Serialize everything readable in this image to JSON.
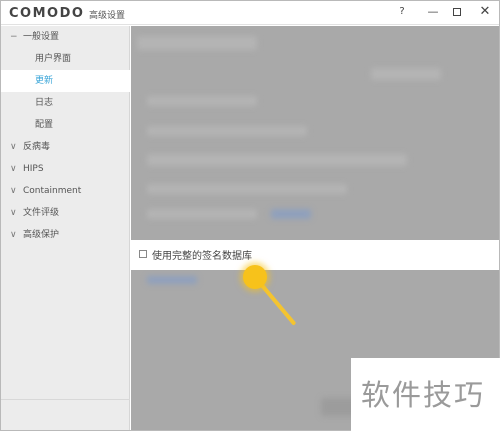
{
  "window": {
    "logo": "COMODO",
    "title": "高级设置",
    "help": "?",
    "minimize": "—",
    "close": "✕"
  },
  "sidebar": {
    "items": [
      {
        "label": "一般设置",
        "chevron": "−"
      },
      {
        "label": "用户界面"
      },
      {
        "label": "更新"
      },
      {
        "label": "日志"
      },
      {
        "label": "配置"
      },
      {
        "label": "反病毒",
        "chevron": "∨"
      },
      {
        "label": "HIPS",
        "chevron": "∨"
      },
      {
        "label": "Containment",
        "chevron": "∨"
      },
      {
        "label": "文件评级",
        "chevron": "∨"
      },
      {
        "label": "高级保护",
        "chevron": "∨"
      }
    ],
    "selected": "更新"
  },
  "content": {
    "option_label": "使用完整的签名数据库",
    "option_checked": false
  },
  "watermark": {
    "text": "软件技巧"
  },
  "colors": {
    "accent": "#3aa5d8",
    "cursor": "#f7c21b",
    "overlay": "#a9a9a9"
  }
}
